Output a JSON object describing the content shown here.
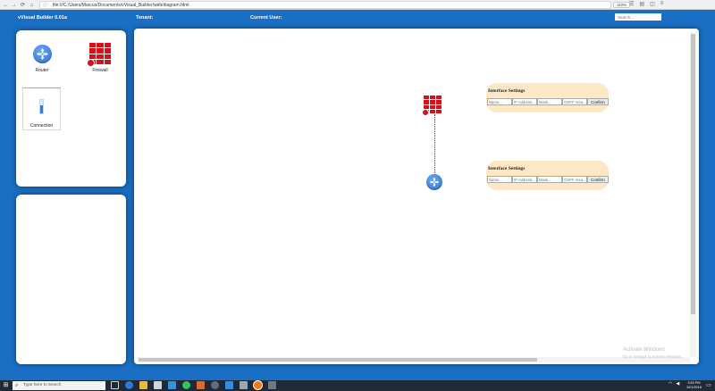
{
  "browser": {
    "url": "file:///C:/Users/Marcus/Documents/vVisual_Builder/web/diagram.html",
    "zoom": "110%",
    "back_glyph": "←",
    "forward_glyph": "→",
    "reload_glyph": "⟳",
    "home_glyph": "⌂",
    "lock_glyph": "ⓘ",
    "reader_glyph": "☰",
    "library_glyph": "▤",
    "sidebar_glyph": "◫",
    "menu_glyph": "≡"
  },
  "app": {
    "title": "vVisual Builder 0.01a",
    "tenant_label": "Tenant:",
    "user_label": "Current User:",
    "search_placeholder": "Search..."
  },
  "palette": {
    "router_label": "Router",
    "firewall_label": "Firewall",
    "connection_label": "Connection"
  },
  "interface_boxes": [
    {
      "title": "Interface Settings",
      "name_placeholder": "Name...",
      "ip_placeholder": "IP Address...",
      "mask_placeholder": "Mask...",
      "ospf_placeholder": "OSPF Area...",
      "confirm_label": "Confirm"
    },
    {
      "title": "Interface Settings",
      "name_placeholder": "Name...",
      "ip_placeholder": "IP Address...",
      "mask_placeholder": "Mask...",
      "ospf_placeholder": "OSPF Area...",
      "confirm_label": "Confirm"
    }
  ],
  "watermark": {
    "title": "Activate Windows",
    "subtitle": "Go to Settings to activate Windows."
  },
  "taskbar": {
    "start_glyph": "⊞",
    "search_glyph": "⌕",
    "search_placeholder": "Type here to search",
    "time": "3:53 PM",
    "date": "10/1/2018",
    "notification_glyph": "▭"
  },
  "colors": {
    "brand_blue": "#1a6fc4",
    "firewall_red": "#d3121c",
    "router_blue": "#2c6fcf",
    "interface_panel": "#fde8c6"
  }
}
